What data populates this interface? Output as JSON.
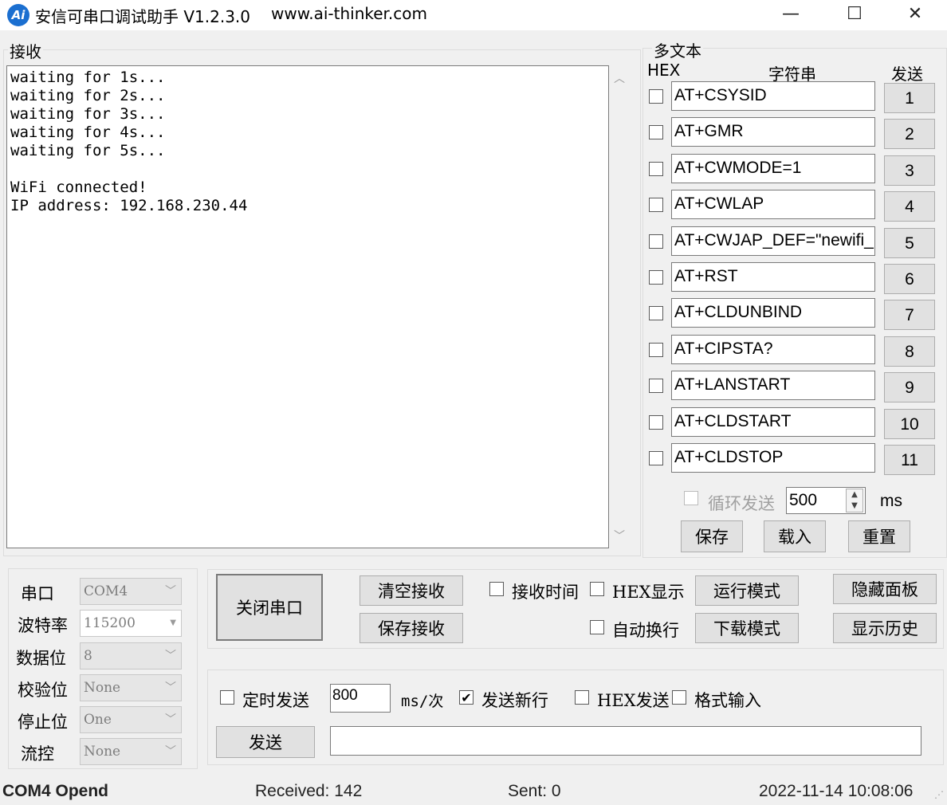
{
  "window": {
    "logo_text": "Ai",
    "title": "安信可串口调试助手 V1.2.3.0",
    "url": "www.ai-thinker.com",
    "minimize_glyph": "—",
    "maximize_glyph": "☐",
    "close_glyph": "✕"
  },
  "receive": {
    "title": "接收",
    "text": "waiting for 1s...\nwaiting for 2s...\nwaiting for 3s...\nwaiting for 4s...\nwaiting for 5s...\n\nWiFi connected!\nIP address: 192.168.230.44"
  },
  "multi": {
    "title": "多文本",
    "hex_header": "HEX",
    "string_header": "字符串",
    "send_header": "发送",
    "rows": [
      {
        "cmd": "AT+CSYSID",
        "btn": "1"
      },
      {
        "cmd": "AT+GMR",
        "btn": "2"
      },
      {
        "cmd": "AT+CWMODE=1",
        "btn": "3"
      },
      {
        "cmd": "AT+CWLAP",
        "btn": "4"
      },
      {
        "cmd": "AT+CWJAP_DEF=\"newifi_",
        "btn": "5"
      },
      {
        "cmd": "AT+RST",
        "btn": "6"
      },
      {
        "cmd": "AT+CLDUNBIND",
        "btn": "7"
      },
      {
        "cmd": "AT+CIPSTA?",
        "btn": "8"
      },
      {
        "cmd": "AT+LANSTART",
        "btn": "9"
      },
      {
        "cmd": "AT+CLDSTART",
        "btn": "10"
      },
      {
        "cmd": "AT+CLDSTOP",
        "btn": "11"
      }
    ],
    "loop_label": "循环发送",
    "loop_interval": "500",
    "loop_unit": "ms",
    "save": "保存",
    "load": "载入",
    "reset": "重置"
  },
  "port": {
    "port_label": "串口",
    "port_value": "COM4",
    "baud_label": "波特率",
    "baud_value": "115200",
    "data_label": "数据位",
    "data_value": "8",
    "parity_label": "校验位",
    "parity_value": "None",
    "stop_label": "停止位",
    "stop_value": "One",
    "flow_label": "流控",
    "flow_value": "None"
  },
  "controls": {
    "close_port": "关闭串口",
    "clear_recv": "清空接收",
    "save_recv": "保存接收",
    "recv_time": "接收时间",
    "hex_display": "HEX显示",
    "auto_wrap": "自动换行",
    "run_mode": "运行模式",
    "download_mode": "下载模式",
    "hide_panel": "隐藏面板",
    "show_history": "显示历史"
  },
  "send": {
    "timed_send": "定时发送",
    "interval": "800",
    "interval_unit": "ms/次",
    "send_newline": "发送新行",
    "send_newline_checked": true,
    "hex_send": "HEX发送",
    "format_input": "格式输入",
    "send_button": "发送",
    "send_text": ""
  },
  "status": {
    "port": "COM4 Opend",
    "received": "Received: 142",
    "sent": "Sent: 0",
    "datetime": "2022-11-14 10:08:06"
  }
}
